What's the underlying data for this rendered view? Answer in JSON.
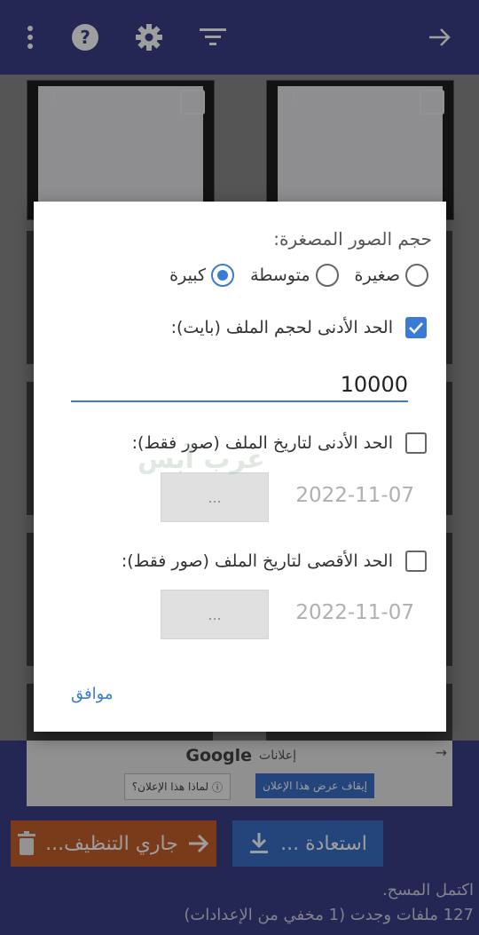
{
  "dialog": {
    "title": "حجم الصور المصغرة:",
    "size_options": [
      {
        "label": "صغيرة",
        "selected": false
      },
      {
        "label": "متوسطة",
        "selected": false
      },
      {
        "label": "كبيرة",
        "selected": true
      }
    ],
    "min_size_label": "الحد الأدنى لحجم الملف (بايت):",
    "min_size_checked": true,
    "min_size_value": "10000",
    "min_date_label": "الحد الأدنى لتاريخ الملف (صور فقط):",
    "min_date_value": "2022-11-07",
    "min_date_button": "...",
    "max_date_label": "الحد الأقصى لتاريخ الملف (صور فقط):",
    "max_date_value": "2022-11-07",
    "max_date_button": "...",
    "ok_label": "موافق"
  },
  "watermark": "عرب آبس",
  "ad": {
    "title": "إعلانات",
    "brand": "Google",
    "stop_label": "إيقاف عرض هذا الإعلان",
    "why_label": "لماذا هذا الإعلان؟"
  },
  "bottom": {
    "clean_label": "جاري التنظيف...",
    "restore_label": "استعادة ..."
  },
  "status": {
    "line1": "اكتمل المسح.",
    "line2": "127 ملفات وجدت (1 مخفي من الإعدادات)"
  },
  "colors": {
    "accent": "#3a7bd5",
    "topbar": "#3a3e86",
    "clean": "#c4602a",
    "restore": "#3a6ec8"
  },
  "icons": [
    "more-vert-icon",
    "help-icon",
    "settings-icon",
    "filter-icon",
    "arrow-right-icon",
    "delete-icon",
    "download-icon",
    "info-icon"
  ]
}
